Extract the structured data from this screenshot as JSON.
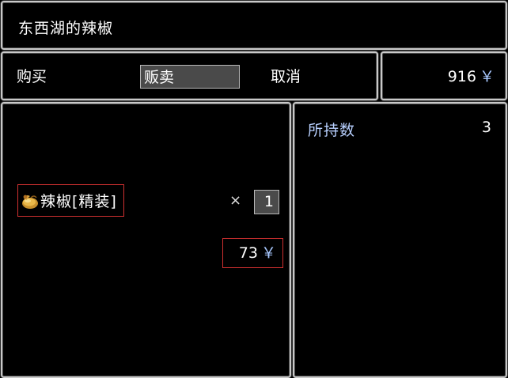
{
  "window": {
    "title": "东西湖的辣椒"
  },
  "commands": {
    "buy": "购买",
    "sell": "贩卖",
    "cancel": "取消",
    "selected": "sell"
  },
  "money": {
    "amount": "916",
    "currency": "￥"
  },
  "item": {
    "icon": "chili-pouch-icon",
    "name": "辣椒[精装]",
    "times": "×",
    "quantity": "1",
    "price": "73",
    "currency": "￥"
  },
  "info": {
    "held_label": "所持数",
    "held_value": "3"
  },
  "colors": {
    "panel_border": "#c9c9c9",
    "selection_bg": "#4a4a4a",
    "highlight_border": "#d03030",
    "label_blue": "#b8d0ff",
    "yen_blue": "#a8c8ff"
  }
}
